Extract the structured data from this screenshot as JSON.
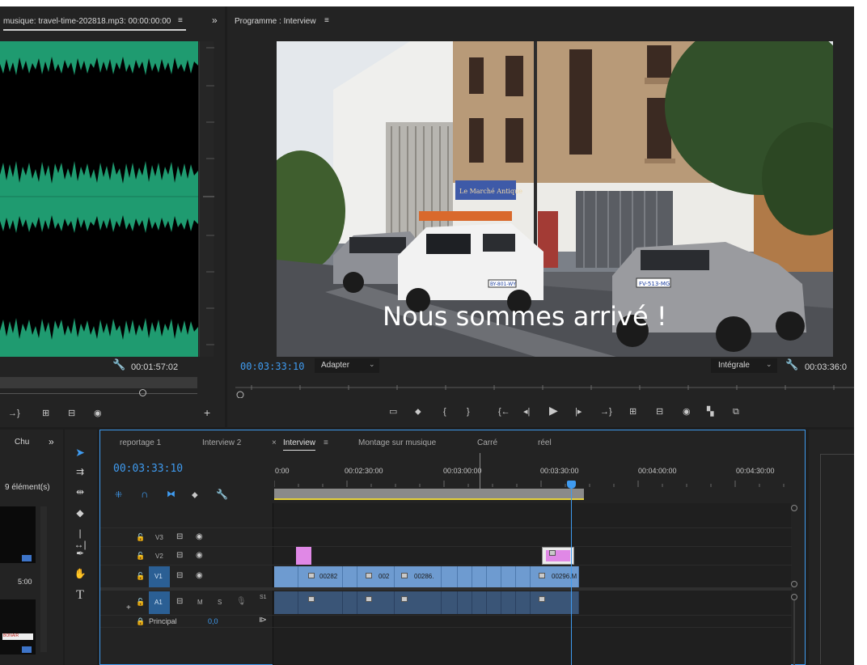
{
  "source_monitor": {
    "title": "musique: travel-time-202818.mp3: 00:00:00:00",
    "menu_icon": "≡",
    "expand_icon": "»",
    "timecode_right": "00:01:57:02"
  },
  "program_monitor": {
    "title": "Programme : Interview",
    "menu_icon": "≡",
    "timecode_current": "00:03:33:10",
    "fit_label": "Adapter",
    "quality_label": "Intégrale",
    "timecode_duration": "00:03:36:0",
    "subtitle": "Nous sommes arrivé !",
    "sign_text": "Le Marché Antique",
    "plate_1": "BY-801-WY",
    "plate_2": "FV-513-MG"
  },
  "project_panel": {
    "tab_label": "Chu",
    "expand_icon": "»",
    "count_label": "9 élément(s)",
    "thumb_duration": "5:00",
    "thumb_badge": "BONAIR"
  },
  "timeline": {
    "tabs": [
      {
        "label": "reportage 1"
      },
      {
        "label": "Interview 2"
      },
      {
        "label": "Interview",
        "close": "×",
        "menu": "≡"
      },
      {
        "label": "Montage sur musique"
      },
      {
        "label": "Carré"
      },
      {
        "label": "réel"
      }
    ],
    "timecode": "00:03:33:10",
    "ruler": [
      "0:00",
      "00:02:30:00",
      "00:03:00:00",
      "00:03:30:00",
      "00:04:00:00",
      "00:04:30:00"
    ],
    "tracks": {
      "v3": "V3",
      "v2": "V2",
      "v1": "V1",
      "a1": "A1",
      "a1_m": "M",
      "a1_s": "S",
      "a1_extra": "S1",
      "principal": "Principal",
      "principal_value": "0,0"
    },
    "clips": [
      "00282",
      "002",
      "00286.",
      "00296.M"
    ]
  },
  "colors": {
    "accent_blue": "#3f9bf0",
    "waveform_green": "#1f9b70",
    "video_clip": "#6e9bd0",
    "audio_clip": "#3a5577",
    "pink_clip": "#e088e6",
    "work_area_yellow": "#e6d23b"
  }
}
